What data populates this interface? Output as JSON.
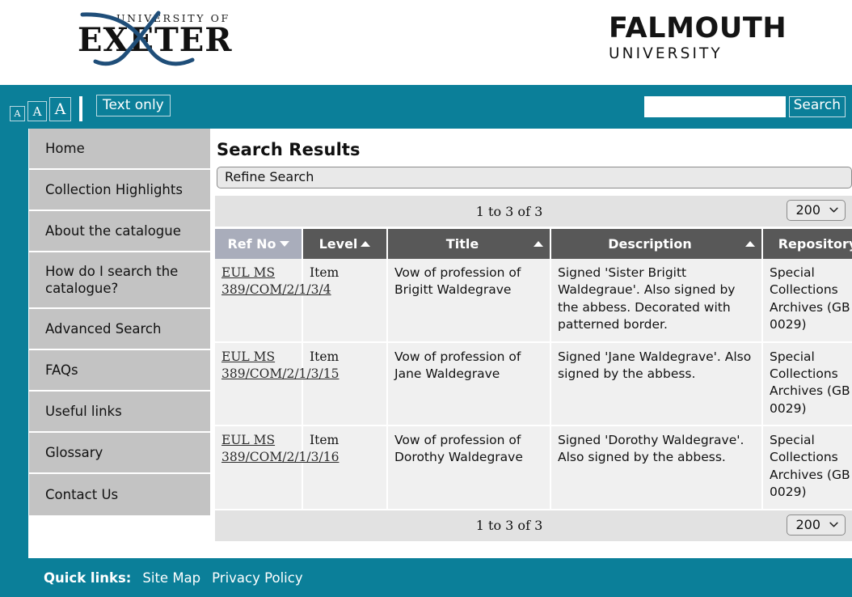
{
  "branding": {
    "exeter": {
      "line1": "UNIVERSITY OF",
      "line2": "EXETER"
    },
    "falmouth": {
      "line1": "FALMOUTH",
      "line2": "UNIVERSITY"
    }
  },
  "utility_bar": {
    "text_size_small": "A",
    "text_size_medium": "A",
    "text_size_large": "A",
    "text_only_label": "Text only",
    "search": {
      "value": "",
      "placeholder": "",
      "button_label": "Search"
    },
    "background_color": "#0b7f99"
  },
  "sidebar": {
    "items": [
      {
        "label": "Home"
      },
      {
        "label": "Collection Highlights"
      },
      {
        "label": "About the catalogue"
      },
      {
        "label": "How do I search the catalogue?"
      },
      {
        "label": "Advanced Search"
      },
      {
        "label": "FAQs"
      },
      {
        "label": "Useful links"
      },
      {
        "label": "Glossary"
      },
      {
        "label": "Contact Us"
      }
    ],
    "background_color": "#c3c3c3"
  },
  "main": {
    "page_title": "Search Results",
    "refine_search_label": "Refine Search",
    "pager_top": {
      "count_text": "1 to 3 of 3",
      "page_size": "200"
    },
    "pager_bottom": {
      "count_text": "1 to 3 of 3",
      "page_size": "200"
    },
    "table": {
      "columns": [
        {
          "label": "Ref No",
          "sort": "down",
          "active": true
        },
        {
          "label": "Level",
          "sort": "up",
          "active": false
        },
        {
          "label": "Title",
          "sort": "up",
          "active": false
        },
        {
          "label": "Description",
          "sort": "up",
          "active": false
        },
        {
          "label": "Repository",
          "sort": "down",
          "active": false
        }
      ],
      "rows": [
        {
          "ref_no": "EUL MS 389/COM/2/1/3/4",
          "level": "Item",
          "title": "Vow of profession of Brigitt Waldegrave",
          "description": "Signed 'Sister Brigitt Waldegraue'. Also signed by the abbess. Decorated with patterned border.",
          "repository": "Special Collections Archives (GB 0029)"
        },
        {
          "ref_no": "EUL MS 389/COM/2/1/3/15",
          "level": "Item",
          "title": "Vow of profession of Jane Waldegrave",
          "description": "Signed 'Jane Waldegrave'. Also signed by the abbess.",
          "repository": "Special Collections Archives (GB 0029)"
        },
        {
          "ref_no": "EUL MS 389/COM/2/1/3/16",
          "level": "Item",
          "title": "Vow of profession of Dorothy Waldegrave",
          "description": "Signed 'Dorothy Waldegrave'. Also signed by the abbess.",
          "repository": "Special Collections Archives (GB 0029)"
        }
      ]
    }
  },
  "footer": {
    "quick_links_label": "Quick links:",
    "links": [
      {
        "label": "Site Map"
      },
      {
        "label": "Privacy Policy"
      }
    ],
    "background_color": "#0b7f99"
  }
}
